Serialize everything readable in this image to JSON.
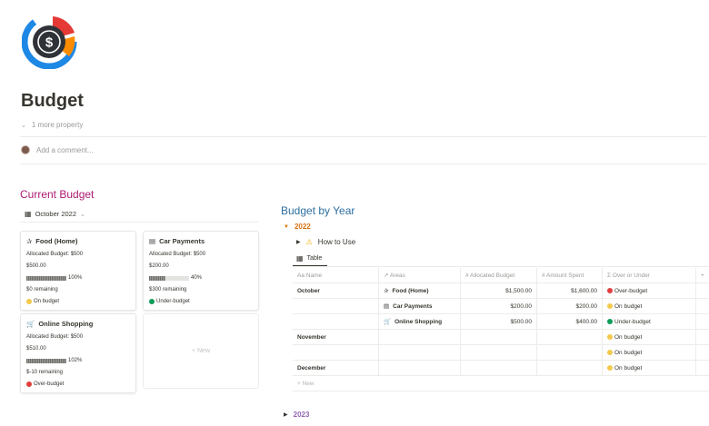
{
  "page": {
    "title": "Budget",
    "more_property": "1 more property",
    "comment_placeholder": "Add a comment..."
  },
  "current_budget": {
    "heading": "Current Budget",
    "month": "October 2022",
    "cards": [
      {
        "title": "Food (Home)",
        "icon": "fork-icon",
        "allocated": "Allocated Budget: $500",
        "spent": "$500.00",
        "percent_label": "100%",
        "percent": 100,
        "remaining": "$0 remaining",
        "status": "On budget",
        "status_color": "#f2c94c"
      },
      {
        "title": "Car Payments",
        "icon": "bus-icon",
        "allocated": "Allocated Budget: $500",
        "spent": "$200.00",
        "percent_label": "40%",
        "percent": 40,
        "remaining": "$300 remaining",
        "status": "Under-budget",
        "status_color": "#0f9d58"
      },
      {
        "title": "Online Shopping",
        "icon": "cart-icon",
        "allocated": "Allocated Budget: $500",
        "spent": "$510.00",
        "percent_label": "102%",
        "percent": 100,
        "remaining": "$-10 remaining",
        "status": "Over-budget",
        "status_color": "#e03e3e"
      }
    ],
    "new_label": "+ New"
  },
  "budget_by_year": {
    "heading": "Budget by Year",
    "year_2022": "2022",
    "how_to_use": "How to Use",
    "table_tab": "Table",
    "columns": [
      "Aa Name",
      "↗ Areas",
      "# Allocated Budget",
      "# Amount Spent",
      "Σ Over or Under",
      "+"
    ],
    "rows": [
      {
        "name": "October",
        "area": "Food (Home)",
        "area_icon": "fork-icon",
        "allocated": "$1,500.00",
        "spent": "$1,600.00",
        "status": "Over-budget",
        "color": "#e03e3e"
      },
      {
        "name": "",
        "area": "Car Payments",
        "area_icon": "bus-icon",
        "allocated": "$200.00",
        "spent": "$200.00",
        "status": "On budget",
        "color": "#f2c94c"
      },
      {
        "name": "",
        "area": "Online Shopping",
        "area_icon": "cart-icon",
        "allocated": "$500.00",
        "spent": "$400.00",
        "status": "Under-budget",
        "color": "#0f9d58"
      },
      {
        "name": "November",
        "area": "",
        "allocated": "",
        "spent": "",
        "status": "On budget",
        "color": "#f2c94c"
      },
      {
        "name": "",
        "area": "",
        "allocated": "",
        "spent": "",
        "status": "On budget",
        "color": "#f2c94c"
      },
      {
        "name": "December",
        "area": "",
        "allocated": "",
        "spent": "",
        "status": "On budget",
        "color": "#f2c94c"
      }
    ],
    "table_new": "+ New",
    "year_2023": "2023"
  },
  "colors": {
    "accent_magenta": "#ad1a72",
    "accent_blue": "#2d6fa0",
    "year_2022": "#d9730d",
    "year_2023": "#9065b0"
  }
}
